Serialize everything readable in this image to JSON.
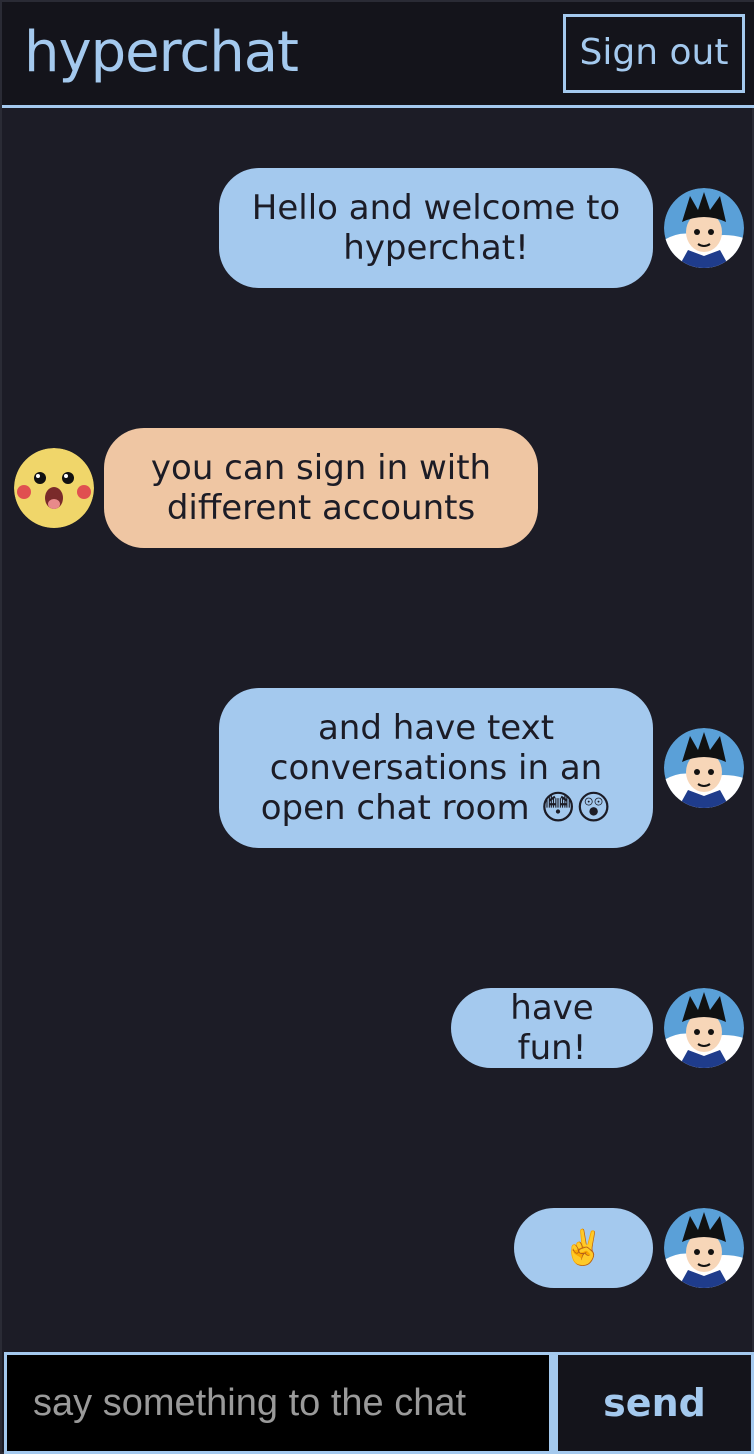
{
  "header": {
    "title": "hyperchat",
    "signout_label": "Sign out"
  },
  "messages": [
    {
      "text": "Hello and welcome to hyperchat!",
      "sender": "goku-avatar",
      "side": "right",
      "color": "#a4c9ee"
    },
    {
      "text": "you can sign in with different accounts",
      "sender": "pikachu-avatar",
      "side": "left",
      "color": "#efc6a3"
    },
    {
      "text": "and have text conversations in an open chat room 😳😲",
      "sender": "goku-avatar",
      "side": "right",
      "color": "#a4c9ee"
    },
    {
      "text": "have fun!",
      "sender": "goku-avatar",
      "side": "right",
      "color": "#a4c9ee"
    },
    {
      "text": "✌️",
      "sender": "goku-avatar",
      "side": "right",
      "color": "#a4c9ee"
    }
  ],
  "composer": {
    "placeholder": "say something to the chat",
    "value": "",
    "send_label": "send"
  },
  "colors": {
    "accent": "#a4c9ee",
    "background": "#1c1c26",
    "header_bg": "#14141b",
    "peach": "#efc6a3"
  }
}
